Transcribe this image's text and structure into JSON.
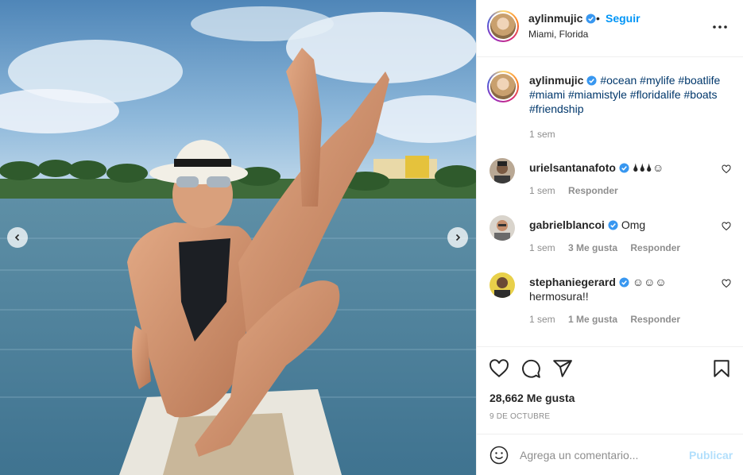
{
  "post": {
    "username": "aylinmujic",
    "verified": true,
    "follow_label": "Seguir",
    "separator": "•",
    "location": "Miami, Florida",
    "more_icon": "more-horizontal-icon"
  },
  "media": {
    "nav_prev_icon": "chevron-left-icon",
    "nav_next_icon": "chevron-right-icon"
  },
  "caption": {
    "username": "aylinmujic",
    "hashtags": "#ocean #mylife #boatlife #miami #miamistyle #floridalife #boats #friendship",
    "time": "1 sem"
  },
  "comments": [
    {
      "username": "urielsantanafoto",
      "text": "🌢🌢🌢☺",
      "time": "1 sem",
      "likes": "",
      "reply": "Responder"
    },
    {
      "username": "gabrielblancoi",
      "text": "Omg",
      "time": "1 sem",
      "likes": "3 Me gusta",
      "reply": "Responder"
    },
    {
      "username": "stephaniegerard",
      "text": "☺☺☺ hermosura!!",
      "time": "1 sem",
      "likes": "1 Me gusta",
      "reply": "Responder"
    }
  ],
  "actions": {
    "like_icon": "heart-icon",
    "comment_icon": "comment-icon",
    "share_icon": "paper-plane-icon",
    "save_icon": "bookmark-icon",
    "likes_count": "28,662 Me gusta",
    "date": "9 de octubre"
  },
  "add_comment": {
    "emoji_icon": "emoji-smile-icon",
    "placeholder": "Agrega un comentario...",
    "post_label": "Publicar"
  },
  "colors": {
    "accent_blue": "#0095f6",
    "hashtag_blue": "#00376b",
    "muted_text": "#8e8e8e",
    "disabled_post": "#b2dffc",
    "border": "#efefef"
  }
}
